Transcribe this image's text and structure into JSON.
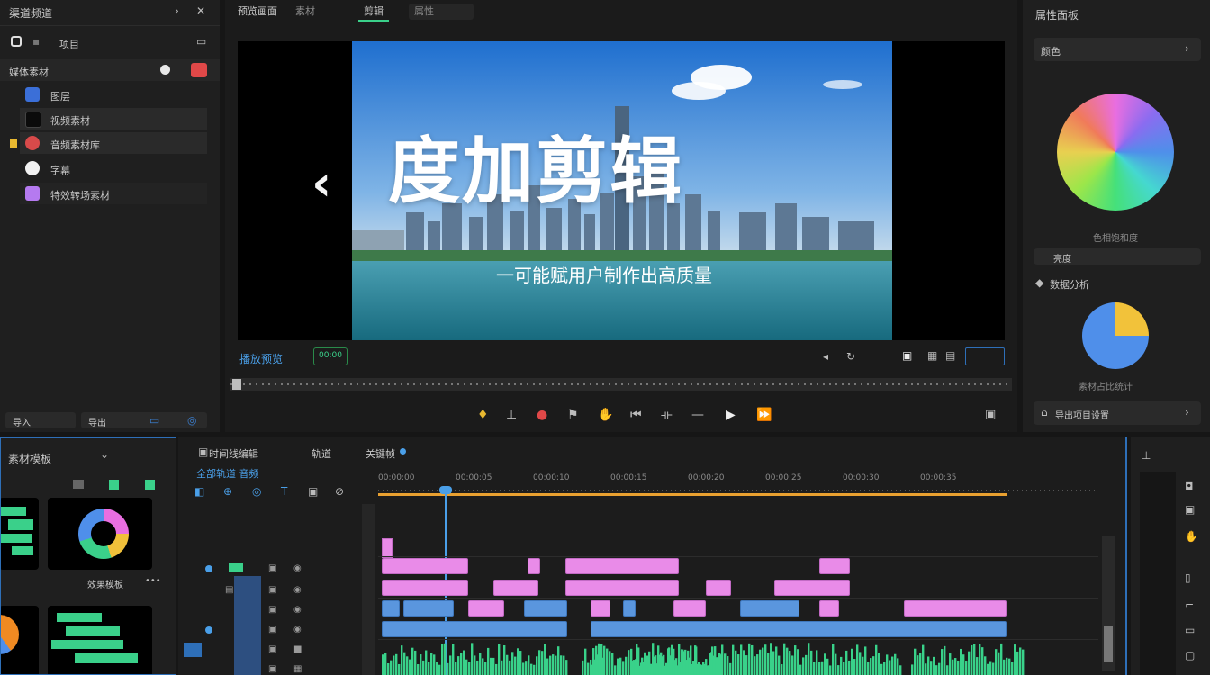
{
  "left_panel": {
    "title": "渠道频道",
    "header_label": "项目",
    "section_title": "媒体素材",
    "items": [
      {
        "label": "图层",
        "color": "#3b6fd8"
      },
      {
        "label": "视频素材",
        "color": "#111111"
      },
      {
        "label": "音频素材库",
        "color": "#d84a4a"
      },
      {
        "label": "字幕",
        "color": "#f2f2f2"
      },
      {
        "label": "特效转场素材",
        "color": "#b57af0"
      }
    ],
    "bottom_labels": [
      "导入",
      "导出"
    ]
  },
  "preview": {
    "tabs": [
      "预览画面",
      "素材",
      "剪辑",
      "属性"
    ],
    "title_text": "度加剪辑",
    "subtitle_text": "一可能赋用户制作出高质量",
    "status_label": "播放预览",
    "time_badge": "00:00"
  },
  "right_panel": {
    "title": "属性面板",
    "dropdown_label": "颜色",
    "wheel_caption": "色相饱和度",
    "bar_label": "亮度",
    "section2_title": "数据分析",
    "pie_caption": "素材占比统计",
    "pie_values": [
      25,
      75
    ],
    "pie_colors": [
      "#f2c23a",
      "#4f8fea"
    ],
    "action_label": "导出项目设置"
  },
  "assets_panel": {
    "title": "素材模板",
    "caption": "效果模板"
  },
  "timeline": {
    "title": "时间线编辑",
    "tab2": "轨道",
    "tab3": "关键帧",
    "subtitle": "全部轨道 音频",
    "ruler_labels": [
      "00:00:00",
      "00:00:05",
      "00:00:10",
      "00:00:15",
      "00:00:20",
      "00:00:25",
      "00:00:30",
      "00:00:35"
    ]
  },
  "colors": {
    "accent": "#2e6fb8",
    "clip_pink": "#e98be8",
    "clip_blue": "#5a96de",
    "clip_green": "#39d28a"
  }
}
